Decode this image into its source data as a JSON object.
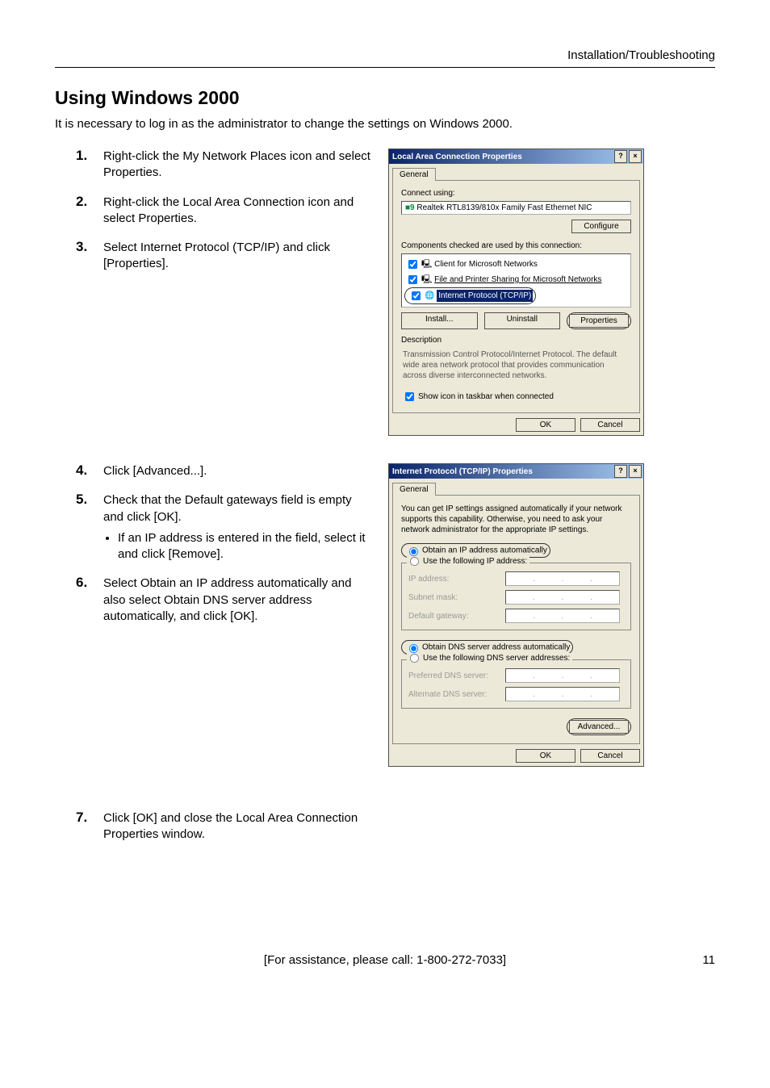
{
  "page_header": "Installation/Troubleshooting",
  "h1": "Using Windows 2000",
  "intro": "It is necessary to log in as the administrator to change the settings on Windows 2000.",
  "steps": {
    "s1": "Right-click the My Network Places icon and select Properties.",
    "s2": "Right-click the Local Area Connection icon and select Properties.",
    "s3": "Select Internet Protocol (TCP/IP) and click [Properties].",
    "s4": "Click [Advanced...].",
    "s5": "Check that the Default gateways field is empty and click [OK].",
    "s5_sub": "If an IP address is entered in the field, select it and click [Remove].",
    "s6": "Select Obtain an IP address automatically and also select Obtain DNS server address automatically, and click [OK].",
    "s7": "Click [OK] and close the Local Area Connection Properties window."
  },
  "dlg1": {
    "title": "Local Area Connection Properties",
    "help": "?",
    "close": "×",
    "tab": "General",
    "connect_using_lbl": "Connect using:",
    "nic_icon": "■9",
    "nic": "Realtek RTL8139/810x Family Fast Ethernet NIC",
    "configure": "Configure",
    "components_lbl": "Components checked are used by this connection:",
    "comp1": "Client for Microsoft Networks",
    "comp2": "File and Printer Sharing for Microsoft Networks",
    "comp3": "Internet Protocol (TCP/IP)",
    "install": "Install...",
    "uninstall": "Uninstall",
    "properties": "Properties",
    "desc_lbl": "Description",
    "desc": "Transmission Control Protocol/Internet Protocol. The default wide area network protocol that provides communication across diverse interconnected networks.",
    "show_icon": "Show icon in taskbar when connected",
    "ok": "OK",
    "cancel": "Cancel"
  },
  "dlg2": {
    "title": "Internet Protocol (TCP/IP) Properties",
    "help": "?",
    "close": "×",
    "tab": "General",
    "blurb": "You can get IP settings assigned automatically if your network supports this capability. Otherwise, you need to ask your network administrator for the appropriate IP settings.",
    "r_auto_ip": "Obtain an IP address automatically",
    "r_use_ip": "Use the following IP address:",
    "ip_lbl": "IP address:",
    "mask_lbl": "Subnet mask:",
    "gw_lbl": "Default gateway:",
    "r_auto_dns": "Obtain DNS server address automatically",
    "r_use_dns": "Use the following DNS server addresses:",
    "pref_dns": "Preferred DNS server:",
    "alt_dns": "Alternate DNS server:",
    "advanced": "Advanced...",
    "ok": "OK",
    "cancel": "Cancel"
  },
  "footer_text": "[For assistance, please call: 1-800-272-7033]",
  "page_number": "11"
}
